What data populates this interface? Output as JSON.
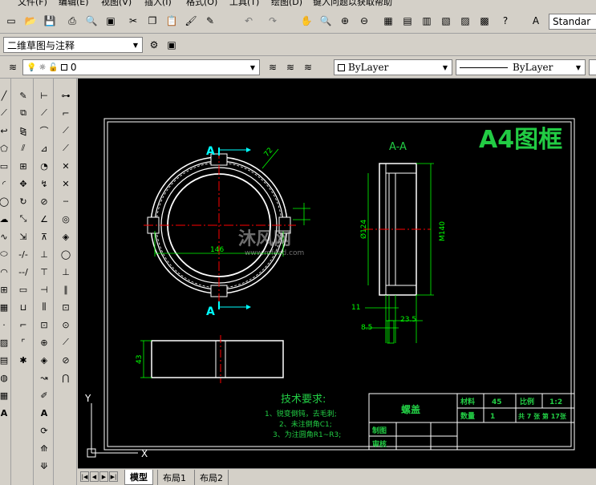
{
  "menu": {
    "items": [
      "文件(F)",
      "编辑(E)",
      "视图(V)",
      "插入(I)",
      "格式(O)",
      "工具(T)",
      "绘图(D)",
      "键入问题以获取帮助"
    ]
  },
  "toolbar": {
    "style_combo": "Standar",
    "workspace": "二维草图与注释",
    "layer": "0",
    "color": "ByLayer",
    "linetype": "ByLayer"
  },
  "drawing": {
    "frame_title": "A4图框",
    "section_label": "A-A",
    "cut_label_top": "A",
    "cut_label_bottom": "A",
    "dims": {
      "d146": "146",
      "d72": "72",
      "phi124": "Ø124",
      "m140": "M140",
      "d11": "11",
      "d8_5": "8.5",
      "d23_5": "23.5",
      "d43": "43"
    },
    "tech": {
      "title": "技术要求:",
      "lines": [
        "1、锐变倒钝，去毛刺;",
        "2、未注倒角C1;",
        "3、为注圆角R1~R3;"
      ]
    },
    "titleblock": {
      "part_name": "螺盖",
      "material_label": "材料",
      "material_value": "45",
      "scale_label": "比例",
      "scale_value": "1:2",
      "qty_label": "数量",
      "qty_value": "1",
      "sheets": "共 7 张  第 17张",
      "drawn_label": "制图",
      "checked_label": "审核"
    },
    "ucs": {
      "x": "X",
      "y": "Y"
    },
    "watermark": {
      "brand": "沐风网",
      "url": "www.mfcad.com"
    }
  },
  "tabs": [
    "模型",
    "布局1",
    "布局2"
  ],
  "colors": {
    "background": "#000000",
    "line": "#ffffff",
    "center": "#ff0000",
    "dimension": "#00ff00",
    "cut_marker": "#00ffff"
  }
}
